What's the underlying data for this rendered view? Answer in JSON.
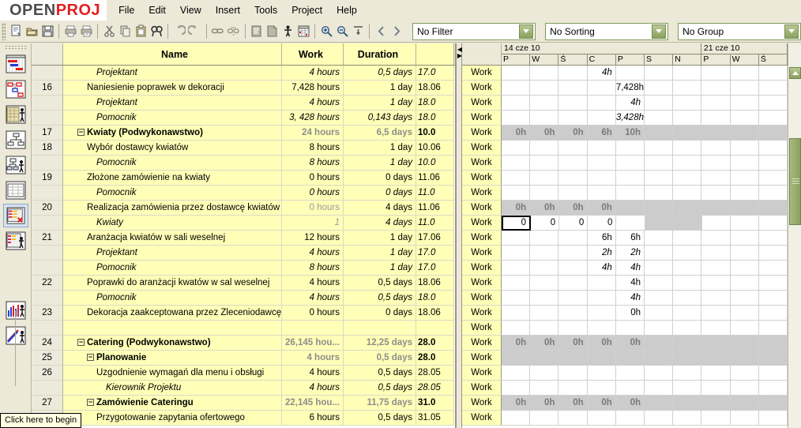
{
  "app": {
    "logo_open": "OPEN",
    "logo_proj": "PROJ"
  },
  "menubar": {
    "items": [
      "File",
      "Edit",
      "View",
      "Insert",
      "Tools",
      "Project",
      "Help"
    ]
  },
  "toolbar": {
    "buttons": [
      "new-icon",
      "open-icon",
      "save-icon",
      "sep",
      "print-icon",
      "print-preview-icon",
      "sep",
      "cut-icon",
      "copy-icon",
      "paste-icon",
      "find-icon",
      "sep",
      "undo-icon",
      "redo-icon",
      "sep",
      "link-icon",
      "unlink-icon",
      "sep",
      "information-icon",
      "notes-icon",
      "assign-resources-icon",
      "calendar-icon",
      "sep",
      "zoom-in-icon",
      "zoom-out-icon",
      "outdent-icon",
      "sep",
      "prev-icon",
      "next-icon"
    ]
  },
  "filters": {
    "filter": {
      "label": "No Filter",
      "name": "filter-combo"
    },
    "sorting": {
      "label": "No Sorting",
      "name": "sorting-combo"
    },
    "group": {
      "label": "No Group",
      "name": "group-combo"
    }
  },
  "sidebar": {
    "items": [
      {
        "name": "sidebar-item-gantt",
        "icon": "gantt-chart-icon",
        "selected": false
      },
      {
        "name": "sidebar-item-network",
        "icon": "network-diagram-icon",
        "selected": false
      },
      {
        "name": "sidebar-item-task-usage",
        "icon": "task-usage-icon",
        "selected": false
      },
      {
        "name": "sidebar-item-wbs",
        "icon": "wbs-icon",
        "selected": false
      },
      {
        "name": "sidebar-item-rbs",
        "icon": "rbs-icon",
        "selected": false
      },
      {
        "name": "sidebar-item-task-sheet",
        "icon": "task-sheet-icon",
        "selected": false
      },
      {
        "name": "sidebar-item-resource-usage",
        "icon": "resource-usage-icon",
        "selected": true
      },
      {
        "name": "sidebar-item-resource-sheet",
        "icon": "resource-sheet-icon",
        "selected": false
      }
    ],
    "bottom_items": [
      {
        "name": "sidebar-item-histogram",
        "icon": "histogram-icon"
      },
      {
        "name": "sidebar-item-reports",
        "icon": "line-chart-icon"
      }
    ]
  },
  "table": {
    "columns": [
      "",
      "Name",
      "Work",
      "Duration",
      ""
    ],
    "work_label_header": "",
    "rows": [
      {
        "id": "",
        "name": "Projektant",
        "work": "4 hours",
        "dur": "0,5 days",
        "date": "17.0",
        "work_label": "Work",
        "kind": "res",
        "indent": 3
      },
      {
        "id": "16",
        "name": "Naniesienie poprawek w dekoracji",
        "work": "7,428 hours",
        "dur": "1 day",
        "date": "18.06",
        "work_label": "Work",
        "kind": "task",
        "indent": 2
      },
      {
        "id": "",
        "name": "Projektant",
        "work": "4 hours",
        "dur": "1 day",
        "date": "18.0",
        "work_label": "Work",
        "kind": "res",
        "indent": 3
      },
      {
        "id": "",
        "name": "Pomocnik",
        "work": "3, 428 hours",
        "dur": "0,143 days",
        "date": "18.0",
        "work_label": "Work",
        "kind": "res",
        "indent": 3
      },
      {
        "id": "17",
        "name": "Kwiaty (Podwykonawstwo)",
        "work": "24 hours",
        "dur": "6,5 days",
        "date": "10.0",
        "work_label": "Work",
        "kind": "summary",
        "indent": 1,
        "expander": true
      },
      {
        "id": "18",
        "name": "Wybór dostawcy kwiatów",
        "work": "8 hours",
        "dur": "1 day",
        "date": "10.06",
        "work_label": "Work",
        "kind": "task",
        "indent": 2
      },
      {
        "id": "",
        "name": "Pomocnik",
        "work": "8 hours",
        "dur": "1 day",
        "date": "10.0",
        "work_label": "Work",
        "kind": "res",
        "indent": 3
      },
      {
        "id": "19",
        "name": "Złożone zamówienie na kwiaty",
        "work": "0 hours",
        "dur": "0 days",
        "date": "11.06",
        "work_label": "Work",
        "kind": "task",
        "indent": 2
      },
      {
        "id": "",
        "name": "Pomocnik",
        "work": "0 hours",
        "dur": "0 days",
        "date": "11.0",
        "work_label": "Work",
        "kind": "res",
        "indent": 3
      },
      {
        "id": "20",
        "name": "Realizacja zamówienia przez dostawcę kwiatów",
        "work": "0 hours",
        "dur": "4 days",
        "date": "11.06",
        "work_label": "Work",
        "kind": "task",
        "indent": 2,
        "work_dim": true
      },
      {
        "id": "",
        "name": "Kwiaty",
        "work": "1",
        "dur": "4 days",
        "date": "11.0",
        "work_label": "Work",
        "kind": "res",
        "indent": 3,
        "work_dim": true
      },
      {
        "id": "21",
        "name": "Aranżacja kwiatów w sali weselnej",
        "work": "12 hours",
        "dur": "1 day",
        "date": "17.06",
        "work_label": "Work",
        "kind": "task",
        "indent": 2
      },
      {
        "id": "",
        "name": "Projektant",
        "work": "4 hours",
        "dur": "1 day",
        "date": "17.0",
        "work_label": "Work",
        "kind": "res",
        "indent": 3
      },
      {
        "id": "",
        "name": "Pomocnik",
        "work": "8 hours",
        "dur": "1 day",
        "date": "17.0",
        "work_label": "Work",
        "kind": "res",
        "indent": 3
      },
      {
        "id": "22",
        "name": "Poprawki do aranżacji kwatów w sal weselnej",
        "work": "4 hours",
        "dur": "0,5 days",
        "date": "18.06",
        "work_label": "Work",
        "kind": "task",
        "indent": 2
      },
      {
        "id": "",
        "name": "Pomocnik",
        "work": "4 hours",
        "dur": "0,5 days",
        "date": "18.0",
        "work_label": "Work",
        "kind": "res",
        "indent": 3
      },
      {
        "id": "23",
        "name": "Dekoracja zaakceptowana przez Zleceniodawcę",
        "work": "0 hours",
        "dur": "0 days",
        "date": "18.06",
        "work_label": "Work",
        "kind": "task",
        "indent": 2
      },
      {
        "id": "",
        "name": "",
        "work": "",
        "dur": "",
        "date": "",
        "work_label": "Work",
        "kind": "blank",
        "indent": 0
      },
      {
        "id": "24",
        "name": "Catering (Podwykonawstwo)",
        "work": "26,145 hou...",
        "dur": "12,25 days",
        "date": "28.0",
        "work_label": "Work",
        "kind": "summary",
        "indent": 1,
        "expander": true
      },
      {
        "id": "25",
        "name": "Planowanie",
        "work": "4 hours",
        "dur": "0,5 days",
        "date": "28.0",
        "work_label": "Work",
        "kind": "summary",
        "indent": 2,
        "expander": true
      },
      {
        "id": "26",
        "name": "Uzgodnienie wymagań dla menu i obsługi",
        "work": "4 hours",
        "dur": "0,5 days",
        "date": "28.05",
        "work_label": "Work",
        "kind": "task",
        "indent": 3
      },
      {
        "id": "",
        "name": "Kierownik Projektu",
        "work": "4 hours",
        "dur": "0,5 days",
        "date": "28.05",
        "work_label": "Work",
        "kind": "res",
        "indent": 4
      },
      {
        "id": "27",
        "name": "Zamówienie Cateringu",
        "work": "22,145 hou...",
        "dur": "11,75 days",
        "date": "31.0",
        "work_label": "Work",
        "kind": "summary",
        "indent": 2,
        "expander": true
      },
      {
        "id": "",
        "name": "Przygotowanie zapytania ofertowego",
        "work": "6 hours",
        "dur": "0,5 days",
        "date": "31.05",
        "work_label": "Work",
        "kind": "task",
        "indent": 3
      }
    ]
  },
  "timescale": {
    "weeks": [
      {
        "label": "14 cze 10",
        "days": 7
      },
      {
        "label": "21 cze 10",
        "days": 3
      }
    ],
    "day_labels": [
      "P",
      "W",
      "Ś",
      "C",
      "P",
      "S",
      "N",
      "P",
      "W",
      "Ś"
    ]
  },
  "usage_grid": {
    "column_count": 10,
    "rows": [
      {
        "kind": "res",
        "cells": [
          "",
          "",
          "",
          "4h",
          "",
          "",
          "",
          "",
          "",
          ""
        ]
      },
      {
        "kind": "task",
        "cells": [
          "",
          "",
          "",
          "",
          "7,428h",
          "",
          "",
          "",
          "",
          ""
        ]
      },
      {
        "kind": "res",
        "cells": [
          "",
          "",
          "",
          "",
          "4h",
          "",
          "",
          "",
          "",
          ""
        ]
      },
      {
        "kind": "res",
        "cells": [
          "",
          "",
          "",
          "",
          "3,428h",
          "",
          "",
          "",
          "",
          ""
        ]
      },
      {
        "kind": "summary",
        "cells": [
          "0h",
          "0h",
          "0h",
          "6h",
          "10h",
          "",
          "",
          "",
          "",
          ""
        ]
      },
      {
        "kind": "task",
        "cells": [
          "",
          "",
          "",
          "",
          "",
          "",
          "",
          "",
          "",
          ""
        ]
      },
      {
        "kind": "res",
        "cells": [
          "",
          "",
          "",
          "",
          "",
          "",
          "",
          "",
          "",
          ""
        ]
      },
      {
        "kind": "task",
        "cells": [
          "",
          "",
          "",
          "",
          "",
          "",
          "",
          "",
          "",
          ""
        ]
      },
      {
        "kind": "res",
        "cells": [
          "",
          "",
          "",
          "",
          "",
          "",
          "",
          "",
          "",
          ""
        ]
      },
      {
        "kind": "summary",
        "cells": [
          "0h",
          "0h",
          "0h",
          "0h",
          "",
          "",
          "",
          "",
          "",
          ""
        ],
        "partial_gray": 6
      },
      {
        "kind": "editing",
        "cells": [
          "0",
          "0",
          "0",
          "0",
          "",
          "",
          "",
          "",
          "",
          ""
        ],
        "selected_index": 0,
        "gray_cells": [
          5,
          6
        ]
      },
      {
        "kind": "task",
        "cells": [
          "",
          "",
          "",
          "6h",
          "6h",
          "",
          "",
          "",
          "",
          ""
        ]
      },
      {
        "kind": "res",
        "cells": [
          "",
          "",
          "",
          "2h",
          "2h",
          "",
          "",
          "",
          "",
          ""
        ]
      },
      {
        "kind": "res",
        "cells": [
          "",
          "",
          "",
          "4h",
          "4h",
          "",
          "",
          "",
          "",
          ""
        ]
      },
      {
        "kind": "task",
        "cells": [
          "",
          "",
          "",
          "",
          "4h",
          "",
          "",
          "",
          "",
          ""
        ]
      },
      {
        "kind": "res",
        "cells": [
          "",
          "",
          "",
          "",
          "4h",
          "",
          "",
          "",
          "",
          ""
        ]
      },
      {
        "kind": "task",
        "cells": [
          "",
          "",
          "",
          "",
          "0h",
          "",
          "",
          "",
          "",
          ""
        ]
      },
      {
        "kind": "blank",
        "cells": [
          "",
          "",
          "",
          "",
          "",
          "",
          "",
          "",
          "",
          ""
        ]
      },
      {
        "kind": "summary",
        "cells": [
          "0h",
          "0h",
          "0h",
          "0h",
          "0h",
          "",
          "",
          "",
          "",
          ""
        ]
      },
      {
        "kind": "summary",
        "cells": [
          "",
          "",
          "",
          "",
          "",
          "",
          "",
          "",
          "",
          ""
        ]
      },
      {
        "kind": "task",
        "cells": [
          "",
          "",
          "",
          "",
          "",
          "",
          "",
          "",
          "",
          ""
        ]
      },
      {
        "kind": "res",
        "cells": [
          "",
          "",
          "",
          "",
          "",
          "",
          "",
          "",
          "",
          ""
        ]
      },
      {
        "kind": "summary",
        "cells": [
          "0h",
          "0h",
          "0h",
          "0h",
          "0h",
          "",
          "",
          "",
          "",
          ""
        ]
      },
      {
        "kind": "task",
        "cells": [
          "",
          "",
          "",
          "",
          "",
          "",
          "",
          "",
          "",
          ""
        ]
      }
    ]
  },
  "status": {
    "tooltip": "Click here to begin"
  },
  "colors": {
    "chrome": "#ece9d8",
    "row_yellow": "#ffffb8",
    "summary_gray": "#cccccc",
    "accent_green": "#8ba05e",
    "logo_red": "#e02020"
  }
}
